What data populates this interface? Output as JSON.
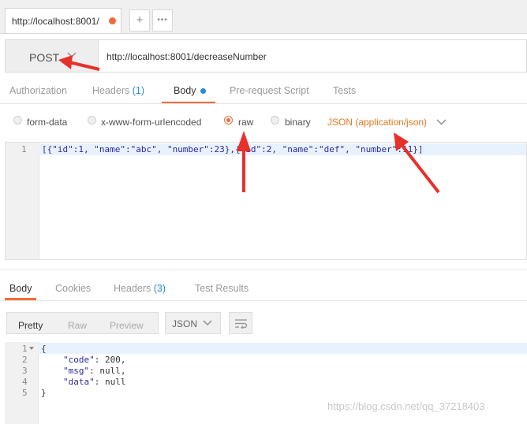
{
  "tab": {
    "label": "http://localhost:8001/",
    "new_tab_glyph": "+",
    "more_glyph": "•••"
  },
  "request": {
    "method": "POST",
    "url": "http://localhost:8001/decreaseNumber"
  },
  "request_tabs": [
    {
      "label": "Authorization"
    },
    {
      "label": "Headers",
      "count": "(1)"
    },
    {
      "label": "Body"
    },
    {
      "label": "Pre-request Script"
    },
    {
      "label": "Tests"
    }
  ],
  "body_modes": [
    {
      "label": "form-data",
      "selected": false
    },
    {
      "label": "x-www-form-urlencoded",
      "selected": false
    },
    {
      "label": "raw",
      "selected": true
    },
    {
      "label": "binary",
      "selected": false
    }
  ],
  "content_type": "JSON (application/json)",
  "request_body": {
    "line_number": "1",
    "text": "[{\"id\":1, \"name\":\"abc\", \"number\":23},{\"id\":2, \"name\":\"def\", \"number\":11}]"
  },
  "response_tabs": [
    {
      "label": "Body"
    },
    {
      "label": "Cookies"
    },
    {
      "label": "Headers",
      "count": "(3)"
    },
    {
      "label": "Test Results"
    }
  ],
  "response_view": {
    "pretty": "Pretty",
    "raw": "Raw",
    "preview": "Preview",
    "format": "JSON"
  },
  "response_body": [
    {
      "n": "1",
      "text": "{"
    },
    {
      "n": "2",
      "key": "\"code\"",
      "rest": ": 200,"
    },
    {
      "n": "3",
      "key": "\"msg\"",
      "rest": ": null,"
    },
    {
      "n": "4",
      "key": "\"data\"",
      "rest": ": null"
    },
    {
      "n": "5",
      "text": "}"
    }
  ],
  "watermark": "https://blog.csdn.net/qq_37218403",
  "colors": {
    "accent": "#f26b3a",
    "link": "#2a8ad4",
    "annotation_arrow": "#e8302a"
  }
}
